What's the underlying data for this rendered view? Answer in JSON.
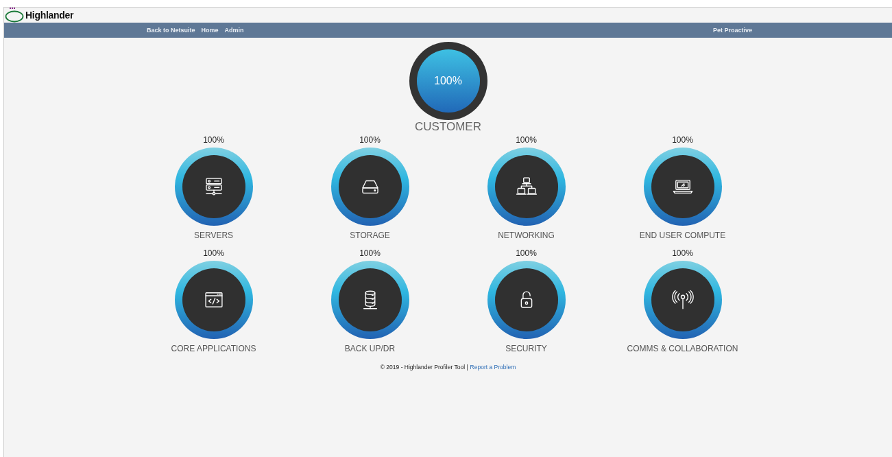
{
  "header": {
    "logo_text": "Highlander"
  },
  "nav": {
    "links": [
      "Back to Netsuite",
      "Home",
      "Admin"
    ],
    "user": "Pet Proactive"
  },
  "customer": {
    "percent": "100%",
    "label": "CUSTOMER"
  },
  "categories": [
    {
      "percent": "100%",
      "label": "SERVERS"
    },
    {
      "percent": "100%",
      "label": "STORAGE"
    },
    {
      "percent": "100%",
      "label": "NETWORKING"
    },
    {
      "percent": "100%",
      "label": "END USER COMPUTE"
    },
    {
      "percent": "100%",
      "label": "CORE APPLICATIONS"
    },
    {
      "percent": "100%",
      "label": "BACK UP/DR"
    },
    {
      "percent": "100%",
      "label": "SECURITY"
    },
    {
      "percent": "100%",
      "label": "COMMS & COLLABORATION"
    }
  ],
  "footer": {
    "text": "© 2019 - Highlander Profiler Tool |",
    "link": "Report a Problem"
  }
}
